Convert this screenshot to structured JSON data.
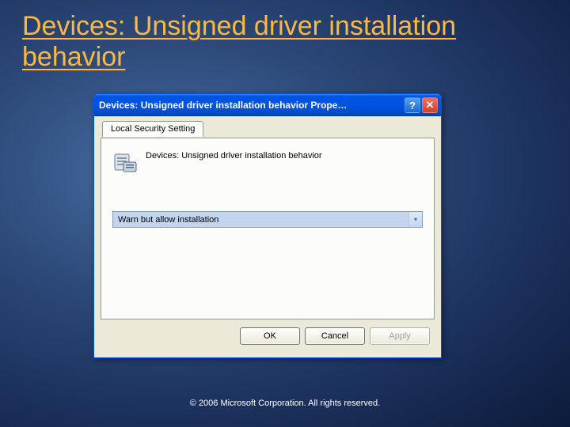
{
  "slide": {
    "title": "Devices: Unsigned driver installation behavior"
  },
  "dialog": {
    "title": "Devices: Unsigned driver installation behavior Prope…",
    "tab_label": "Local Security Setting",
    "setting_label": "Devices: Unsigned driver installation behavior",
    "dropdown_value": "Warn but allow installation",
    "buttons": {
      "ok": "OK",
      "cancel": "Cancel",
      "apply": "Apply"
    }
  },
  "footer": "© 2006 Microsoft Corporation. All rights reserved."
}
